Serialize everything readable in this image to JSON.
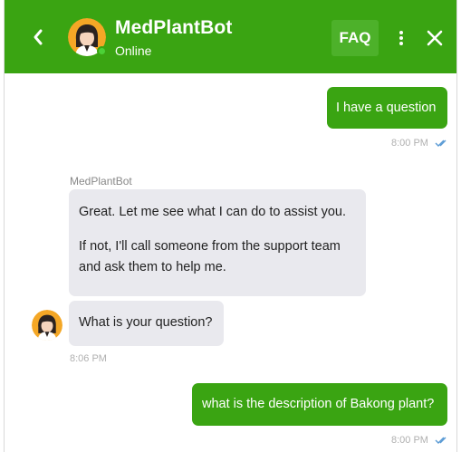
{
  "header": {
    "bot_name": "MedPlantBot",
    "status": "Online",
    "faq_label": "FAQ",
    "back_icon": "chevron-left-icon",
    "menu_icon": "more-vertical-icon",
    "close_icon": "close-icon"
  },
  "messages": [
    {
      "from": "user",
      "text": "I have a question",
      "time": "8:00 PM",
      "read": true
    },
    {
      "from": "bot",
      "sender": "MedPlantBot",
      "paragraphs": [
        "Great. Let me see what I can do to assist you.",
        "If not,  I'll call someone from the support team and ask them to help me."
      ]
    },
    {
      "from": "bot",
      "text": "What is your question?",
      "time": "8:06 PM"
    },
    {
      "from": "user",
      "text": "what is the description of Bakong plant?",
      "time": "8:00 PM",
      "read": true
    }
  ],
  "colors": {
    "brand_green": "#3aa412",
    "faq_bg": "#4db12a",
    "bot_bubble": "#e9e9ee",
    "online_dot": "#4cd137",
    "read_ticks": "#5b9bd5"
  }
}
